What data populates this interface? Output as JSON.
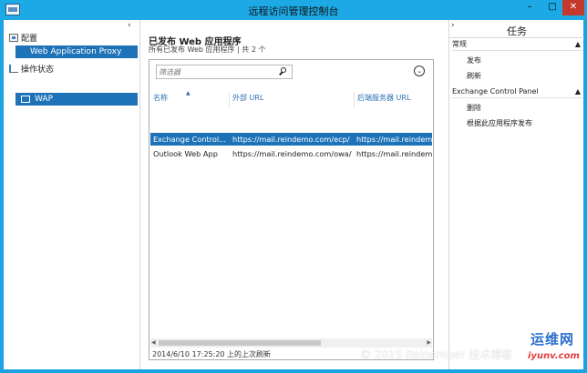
{
  "window": {
    "title": "远程访问管理控制台",
    "minimize": "–",
    "maximize": "□",
    "close": "✕"
  },
  "nav": {
    "collapse": "‹",
    "config_label": "配置",
    "proxy_label": "Web Application Proxy",
    "status_label": "操作状态",
    "wap_label": "WAP"
  },
  "main": {
    "title": "已发布 Web 应用程序",
    "subtitle": "所有已发布 Web 应用程序 | 共 2 个",
    "filter_placeholder": "筛选器",
    "options": "⌄",
    "columns": [
      "名称",
      "外部 URL",
      "后端服务器 URL"
    ],
    "rows": [
      {
        "name": "Exchange Control...",
        "external_url": "https://mail.reindemo.com/ecp/",
        "backend_url": "https://mail.reindemo",
        "selected": true
      },
      {
        "name": "Outlook Web App",
        "external_url": "https://mail.reindemo.com/owa/",
        "backend_url": "https://mail.reindemo",
        "selected": false
      }
    ],
    "status": "2014/6/10 17:25:20 上的上次刷新"
  },
  "tasks": {
    "collapse": "›",
    "title": "任务",
    "sections": [
      {
        "label": "常规",
        "items": [
          "发布",
          "刷新"
        ]
      },
      {
        "label": "Exchange Control Panel",
        "items": [
          "删除",
          "根据此应用程序发布"
        ]
      }
    ]
  },
  "overlay": {
    "watermark": "© 2015 Reinember 技术博客",
    "logo_main": "运维网",
    "logo_sub": "iyunv.com"
  }
}
